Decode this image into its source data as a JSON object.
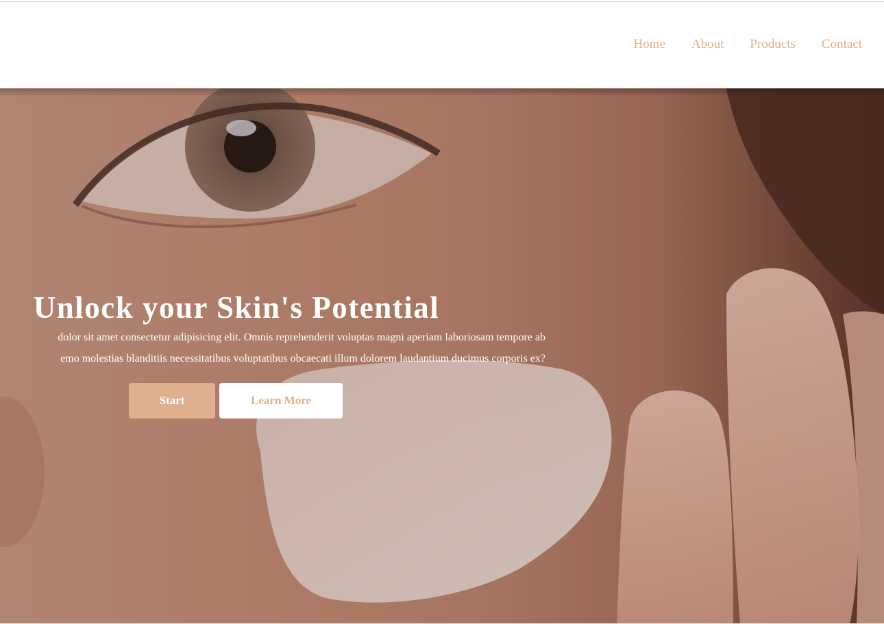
{
  "nav": {
    "items": [
      {
        "label": "Home"
      },
      {
        "label": "About"
      },
      {
        "label": "Products"
      },
      {
        "label": "Contact"
      }
    ]
  },
  "hero": {
    "title": "Unlock your Skin's Potential",
    "description_line1": "dolor sit amet consectetur adipisicing elit. Omnis reprehenderit voluptas magni aperiam laboriosam tempore ab",
    "description_line2": "emo molestias blanditiis necessitatibus voluptatibus obcaecati illum dolorem laudantium ducimus corporis ex?",
    "start_label": "Start",
    "learn_more_label": "Learn More"
  },
  "colors": {
    "accent": "#dfb08d",
    "hero_text": "#ffffff"
  }
}
